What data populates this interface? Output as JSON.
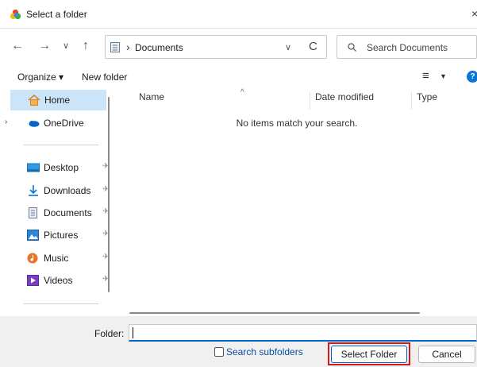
{
  "window": {
    "title": "Select a folder",
    "close_glyph": "×"
  },
  "nav": {
    "back": "←",
    "forward": "→",
    "recent": "∨",
    "up": "↑"
  },
  "address": {
    "separator": "›",
    "path": "Documents",
    "dropdown": "∨",
    "refresh": "C"
  },
  "search": {
    "placeholder": "Search Documents"
  },
  "toolbar": {
    "organize": "Organize ▾",
    "new_folder": "New folder",
    "view": "≡",
    "view_drop": "▼",
    "help": "?"
  },
  "sidebar": {
    "items": [
      {
        "label": "Home",
        "icon": "home-icon",
        "selected": true
      },
      {
        "label": "OneDrive",
        "icon": "cloud-icon",
        "expander": "›"
      },
      {
        "label": "Desktop",
        "icon": "desktop-icon",
        "pinned": true
      },
      {
        "label": "Downloads",
        "icon": "download-icon",
        "pinned": true
      },
      {
        "label": "Documents",
        "icon": "document-icon",
        "pinned": true
      },
      {
        "label": "Pictures",
        "icon": "picture-icon",
        "pinned": true
      },
      {
        "label": "Music",
        "icon": "music-icon",
        "pinned": true
      },
      {
        "label": "Videos",
        "icon": "video-icon",
        "pinned": true
      }
    ],
    "pin_glyph": "✈"
  },
  "filelist": {
    "columns": [
      "Name",
      "Date modified",
      "Type"
    ],
    "sort_glyph": "^",
    "empty_message": "No items match your search."
  },
  "bottom": {
    "folder_label": "Folder:",
    "folder_value": "",
    "search_subfolders": "Search subfolders",
    "select_button": "Select Folder",
    "cancel_button": "Cancel"
  },
  "colors": {
    "accent": "#0067c0",
    "selected_bg": "#cce4f7",
    "highlight": "#d81818"
  }
}
